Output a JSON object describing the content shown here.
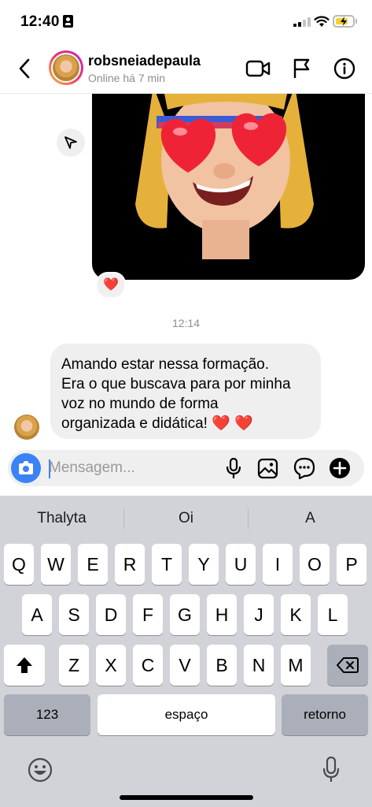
{
  "status_bar": {
    "time": "12:40"
  },
  "header": {
    "back_icon": "chevron-left-icon",
    "contact_name": "robsneiadepaula",
    "contact_status": "Online há 7 min",
    "actions": [
      "video-call-icon",
      "flag-icon",
      "info-icon"
    ]
  },
  "messages": {
    "sent_image": {
      "description_icon": "memoji-heart-eyes-image",
      "reaction": "❤️"
    },
    "timestamp": "12:14",
    "received": {
      "text": "Amando estar nessa formação.\nEra o que buscava para por minha\nvoz no mundo de forma\norganizada e didática! ❤️ ❤️"
    }
  },
  "composer": {
    "placeholder": "Mensagem...",
    "icons": [
      "camera-icon",
      "microphone-icon",
      "gallery-icon",
      "sticker-icon",
      "add-icon"
    ]
  },
  "keyboard": {
    "suggestions": [
      "Thalyta",
      "Oi",
      "A"
    ],
    "row1": [
      "Q",
      "W",
      "E",
      "R",
      "T",
      "Y",
      "U",
      "I",
      "O",
      "P"
    ],
    "row2": [
      "A",
      "S",
      "D",
      "F",
      "G",
      "H",
      "J",
      "K",
      "L"
    ],
    "row3": [
      "Z",
      "X",
      "C",
      "V",
      "B",
      "N",
      "M"
    ],
    "numbers_key": "123",
    "space_key": "espaço",
    "return_key": "retorno"
  },
  "colors": {
    "accent": "#3b82f6",
    "bubble": "#efefef",
    "keyboard_bg": "#d1d3d9"
  }
}
